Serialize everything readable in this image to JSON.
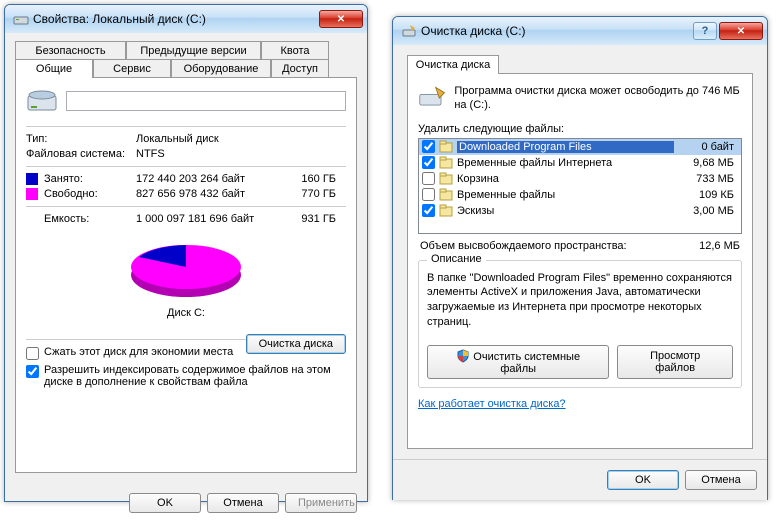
{
  "w1": {
    "title": "Свойства: Локальный диск (C:)",
    "tabs_top": [
      "Безопасность",
      "Предыдущие версии",
      "Квота"
    ],
    "tabs_bottom": [
      "Общие",
      "Сервис",
      "Оборудование",
      "Доступ"
    ],
    "type_label": "Тип:",
    "type_value": "Локальный диск",
    "fs_label": "Файловая система:",
    "fs_value": "NTFS",
    "used_label": "Занято:",
    "used_bytes": "172 440 203 264 байт",
    "used_gb": "160 ГБ",
    "free_label": "Свободно:",
    "free_bytes": "827 656 978 432 байт",
    "free_gb": "770 ГБ",
    "cap_label": "Емкость:",
    "cap_bytes": "1 000 097 181 696 байт",
    "cap_gb": "931 ГБ",
    "disk_label": "Диск C:",
    "cleanup_btn": "Очистка диска",
    "compress_label": "Сжать этот диск для экономии места",
    "index_label": "Разрешить индексировать содержимое файлов на этом диске в дополнение к свойствам файла",
    "ok": "OK",
    "cancel": "Отмена",
    "apply": "Применить",
    "colors": {
      "used": "#0000c8",
      "free": "#ff00ff"
    }
  },
  "w2": {
    "title": "Очистка диска  (C:)",
    "tab": "Очистка диска",
    "info_text": "Программа очистки диска может освободить до 746 МБ на  (C:).",
    "delete_label": "Удалить следующие файлы:",
    "files": [
      {
        "checked": true,
        "name": "Downloaded Program Files",
        "size": "0 байт",
        "selected": true
      },
      {
        "checked": true,
        "name": "Временные файлы Интернета",
        "size": "9,68 МБ"
      },
      {
        "checked": false,
        "name": "Корзина",
        "size": "733 МБ"
      },
      {
        "checked": false,
        "name": "Временные файлы",
        "size": "109 КБ"
      },
      {
        "checked": true,
        "name": "Эскизы",
        "size": "3,00 МБ"
      }
    ],
    "total_label": "Объем высвобождаемого пространства:",
    "total_value": "12,6 МБ",
    "desc_title": "Описание",
    "desc_text": "В папке \"Downloaded Program Files\" временно сохраняются элементы ActiveX и приложения Java, автоматически загружаемые из Интернета при просмотре некоторых страниц.",
    "clean_sys_btn": "Очистить системные файлы",
    "view_files_btn": "Просмотр файлов",
    "how_link": "Как работает очистка диска?",
    "ok": "OK",
    "cancel": "Отмена"
  }
}
